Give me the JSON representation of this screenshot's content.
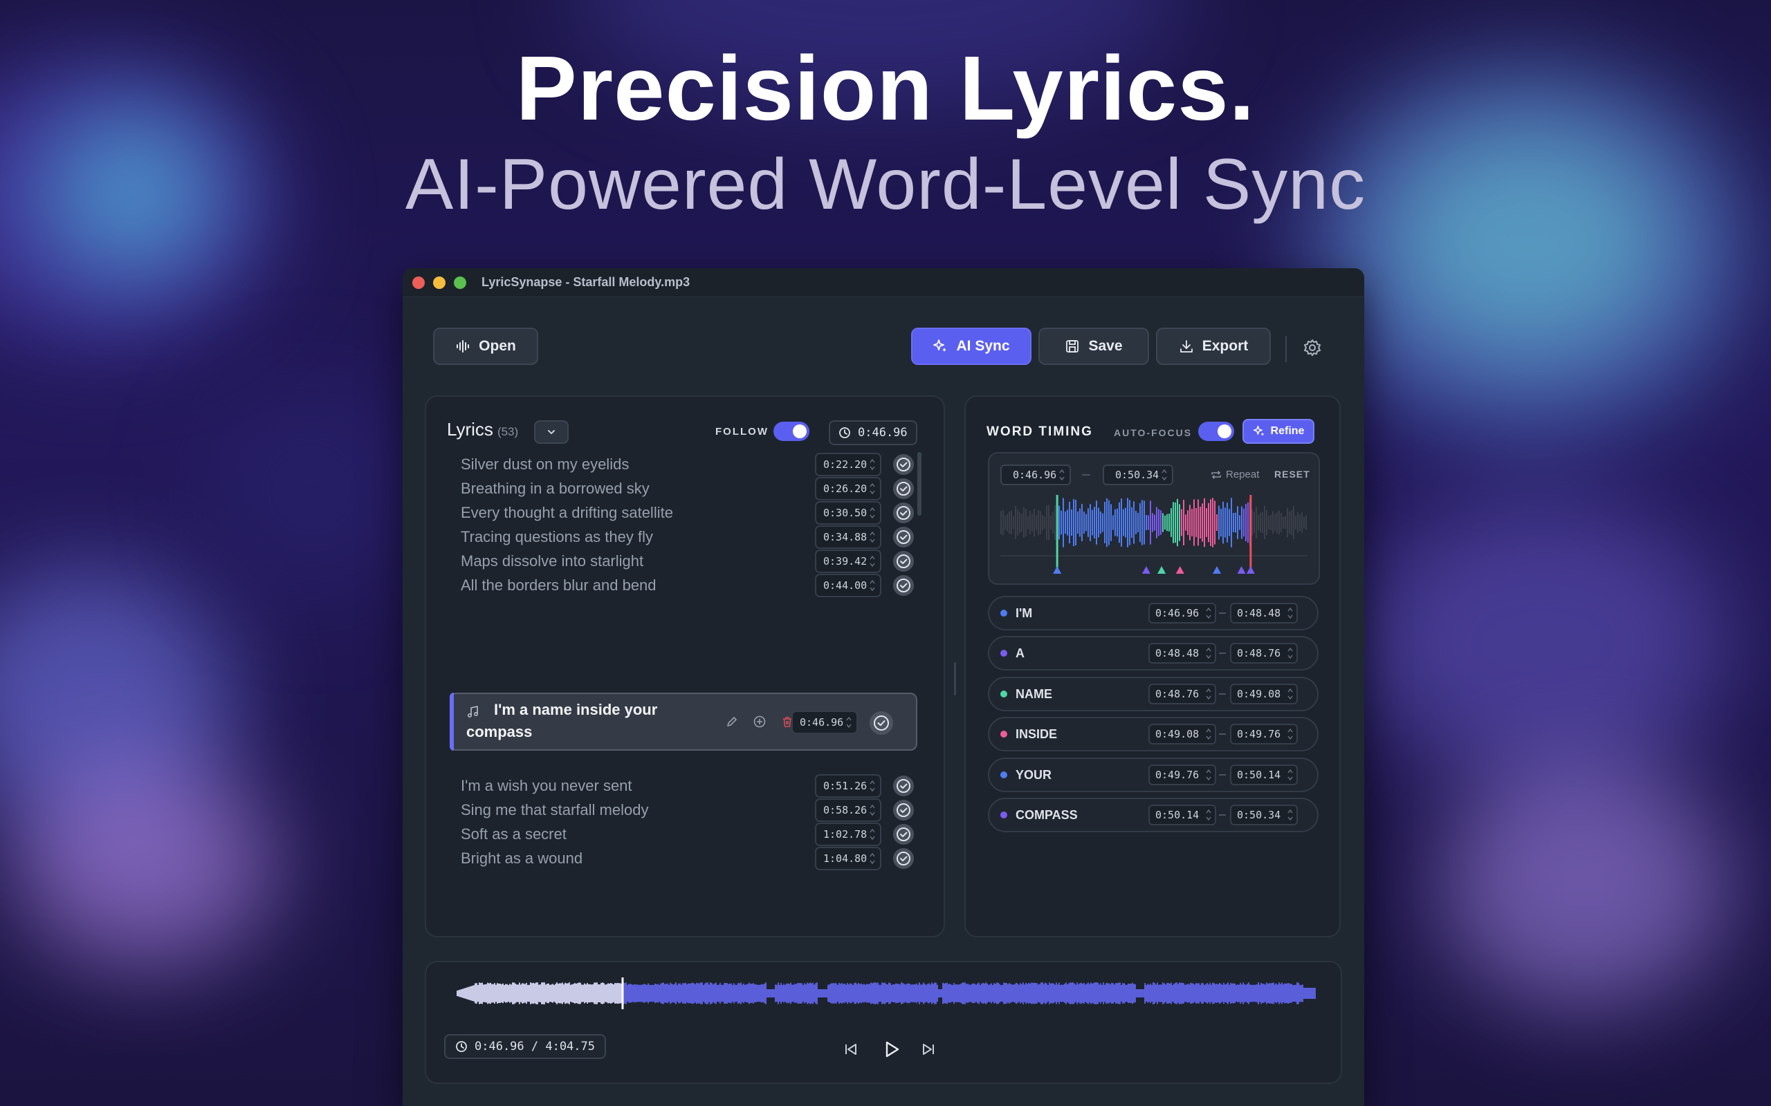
{
  "hero": {
    "title": "Precision Lyrics.",
    "subtitle": "AI-Powered Word-Level Sync"
  },
  "window": {
    "title": "LyricSynapse - Starfall Melody.mp3"
  },
  "toolbar": {
    "open_label": "Open",
    "ai_sync_label": "AI Sync",
    "save_label": "Save",
    "export_label": "Export",
    "icons": [
      "waveform-icon",
      "sparkles-icon",
      "save-icon",
      "download-icon",
      "gear-icon"
    ]
  },
  "lyrics": {
    "title": "Lyrics",
    "count": "(53)",
    "follow_label": "FOLLOW",
    "current_time": "0:46.96",
    "rows": [
      {
        "text": "Silver dust on my eyelids",
        "time": "0:22.20"
      },
      {
        "text": "Breathing in a borrowed sky",
        "time": "0:26.20"
      },
      {
        "text": "Every thought a drifting satellite",
        "time": "0:30.50"
      },
      {
        "text": "Tracing questions as they fly",
        "time": "0:34.88"
      },
      {
        "text": "Maps dissolve into starlight",
        "time": "0:39.42"
      },
      {
        "text": "All the borders blur and bend",
        "time": "0:44.00"
      },
      {
        "text": "I'm a wish you never sent",
        "time": "0:51.26"
      },
      {
        "text": "Sing me that starfall melody",
        "time": "0:58.26"
      },
      {
        "text": "Soft as a secret",
        "time": "1:02.78"
      },
      {
        "text": "Bright as a wound",
        "time": "1:04.80"
      }
    ],
    "active": {
      "line1": "I'm a name inside your",
      "line2": "compass",
      "time": "0:46.96"
    }
  },
  "word_timing": {
    "title": "WORD TIMING",
    "autofocus_label": "AUTO-FOCUS",
    "refine_label": "Refine",
    "range_start": "0:46.96",
    "range_end": "0:50.34",
    "repeat_label": "Repeat",
    "reset_label": "RESET",
    "words": [
      {
        "word": "I'M",
        "start": "0:46.96",
        "end": "0:48.48",
        "color": "#4f7cf0"
      },
      {
        "word": "A",
        "start": "0:48.48",
        "end": "0:48.76",
        "color": "#7a5cf0"
      },
      {
        "word": "NAME",
        "start": "0:48.76",
        "end": "0:49.08",
        "color": "#4fd6a6"
      },
      {
        "word": "INSIDE",
        "start": "0:49.08",
        "end": "0:49.76",
        "color": "#ef5b9c"
      },
      {
        "word": "YOUR",
        "start": "0:49.76",
        "end": "0:50.14",
        "color": "#4f7cf0"
      },
      {
        "word": "COMPASS",
        "start": "0:50.14",
        "end": "0:50.34",
        "color": "#7a5cf0"
      }
    ]
  },
  "transport": {
    "time_display": "0:46.96 / 4:04.75",
    "progress": 0.192
  },
  "colors": {
    "accent": "#5b5ff0",
    "background": "#1f2731"
  }
}
